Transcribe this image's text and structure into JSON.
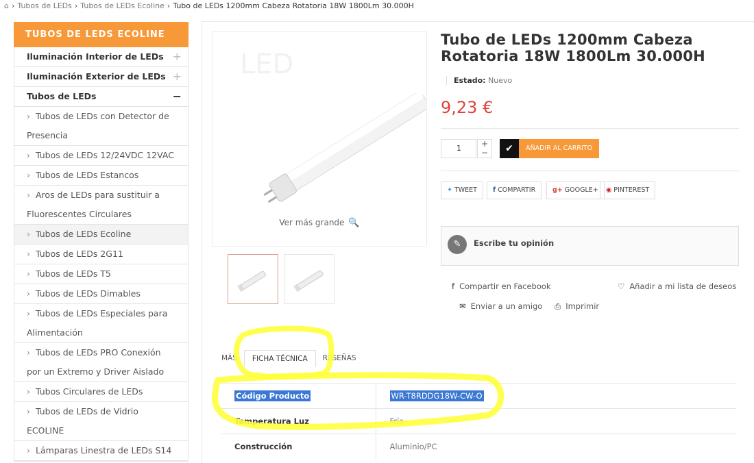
{
  "breadcrumb": {
    "items": [
      "Tubos de LEDs",
      "Tubos de LEDs Ecoline"
    ],
    "current": "Tubo de LEDs 1200mm Cabeza Rotatoria 18W 1800Lm 30.000H"
  },
  "sidebar": {
    "title": "TUBOS DE LEDS ECOLINE",
    "items": [
      {
        "label": "Iluminación Interior de LEDs"
      },
      {
        "label": "Iluminación Exterior de LEDs"
      },
      {
        "label": "Tubos de LEDs"
      },
      {
        "label": "Tubos de LEDs con Detector de"
      },
      {
        "label": "Presencia"
      },
      {
        "label": "Tubos de LEDs 12/24VDC 12VAC"
      },
      {
        "label": "Tubos de LEDs Estancos"
      },
      {
        "label": "Aros de LEDs para sustituir a"
      },
      {
        "label": "Fluorescentes Circulares"
      },
      {
        "label": "Tubos de LEDs Ecoline"
      },
      {
        "label": "Tubos de LEDs 2G11"
      },
      {
        "label": "Tubos de LEDs T5"
      },
      {
        "label": "Tubos de LEDs Dimables"
      },
      {
        "label": "Tubos de LEDs Especiales para"
      },
      {
        "label": "Alimentación"
      },
      {
        "label": "Tubos de LEDs PRO Conexión"
      },
      {
        "label": "por un Extremo y Driver Aislado"
      },
      {
        "label": "Tubos Circulares de LEDs"
      },
      {
        "label": "Tubos de LEDs de Vidrio"
      },
      {
        "label": "ECOLINE"
      },
      {
        "label": "Lámparas Linestra de LEDs S14"
      }
    ]
  },
  "product": {
    "title": "Tubo de LEDs 1200mm Cabeza Rotatoria 18W 1800Lm 30.000H",
    "estado_label": "Estado:",
    "estado_value": "Nuevo",
    "price": "9,23 €",
    "quantity": "1",
    "add_to_cart": "AÑADIR AL CARRITO",
    "zoom_label": "Ver más grande"
  },
  "share": {
    "tweet": "TWEET",
    "compartir": "COMPARTIR",
    "google": "GOOGLE+",
    "pinterest": "PINTEREST"
  },
  "review": {
    "label": "Escribe tu opinión"
  },
  "links": {
    "facebook": "Compartir en Facebook",
    "wishlist": "Añadir a mi lista de deseos",
    "friend": "Enviar a un amigo",
    "print": "Imprimir"
  },
  "tabs": [
    "MÁS",
    "FICHA TÉCNICA",
    "RESEÑAS"
  ],
  "spec_table": [
    {
      "key": "Código Producto",
      "value": "WR-T8RDDG18W-CW-O"
    },
    {
      "key": "Temperatura Luz",
      "value": "Frío"
    },
    {
      "key": "Construcción",
      "value": "Aluminio/PC"
    }
  ],
  "colors": {
    "accent": "#f89939",
    "price": "#e2413a",
    "highlighter": "#ffff3c"
  }
}
